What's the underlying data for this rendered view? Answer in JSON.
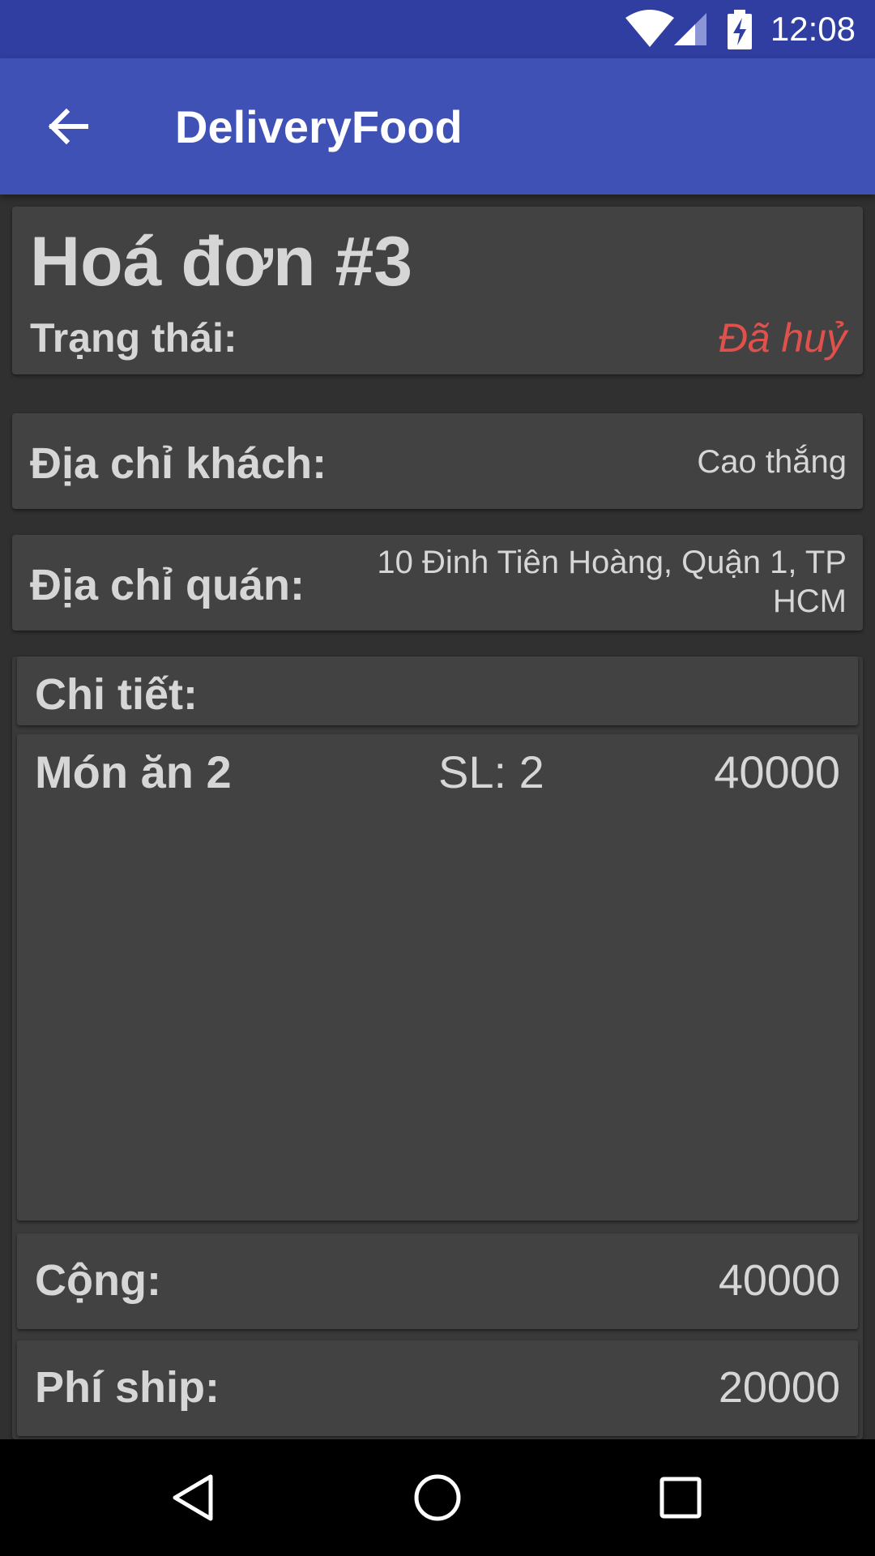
{
  "status_bar": {
    "time": "12:08",
    "icons": [
      "wifi-icon",
      "cell-signal-icon",
      "battery-charging-icon"
    ],
    "background": "#2f3ea0"
  },
  "app_bar": {
    "title": "DeliveryFood",
    "back_icon": "arrow-back-icon",
    "background": "#3f51b5"
  },
  "invoice": {
    "title": "Hoá đơn #3",
    "status_label": "Trạng thái:",
    "status_value": "Đã huỷ",
    "status_color": "#e0514c"
  },
  "customer_address": {
    "label": "Địa chỉ khách:",
    "value": "Cao thắng"
  },
  "shop_address": {
    "label": "Địa chỉ quán:",
    "value_line1": "10 Đinh Tiên Hoàng, Quận 1, TP",
    "value_line2": "HCM"
  },
  "details": {
    "header": "Chi tiết:",
    "items": [
      {
        "name": "Món ăn 2",
        "quantity": "SL: 2",
        "price": "40000"
      }
    ],
    "subtotal_label": "Cộng:",
    "subtotal_value": "40000",
    "shipping_label": "Phí ship:",
    "shipping_value": "20000"
  },
  "nav_bar": {
    "icons": [
      "nav-back-icon",
      "nav-home-icon",
      "nav-recents-icon"
    ]
  }
}
